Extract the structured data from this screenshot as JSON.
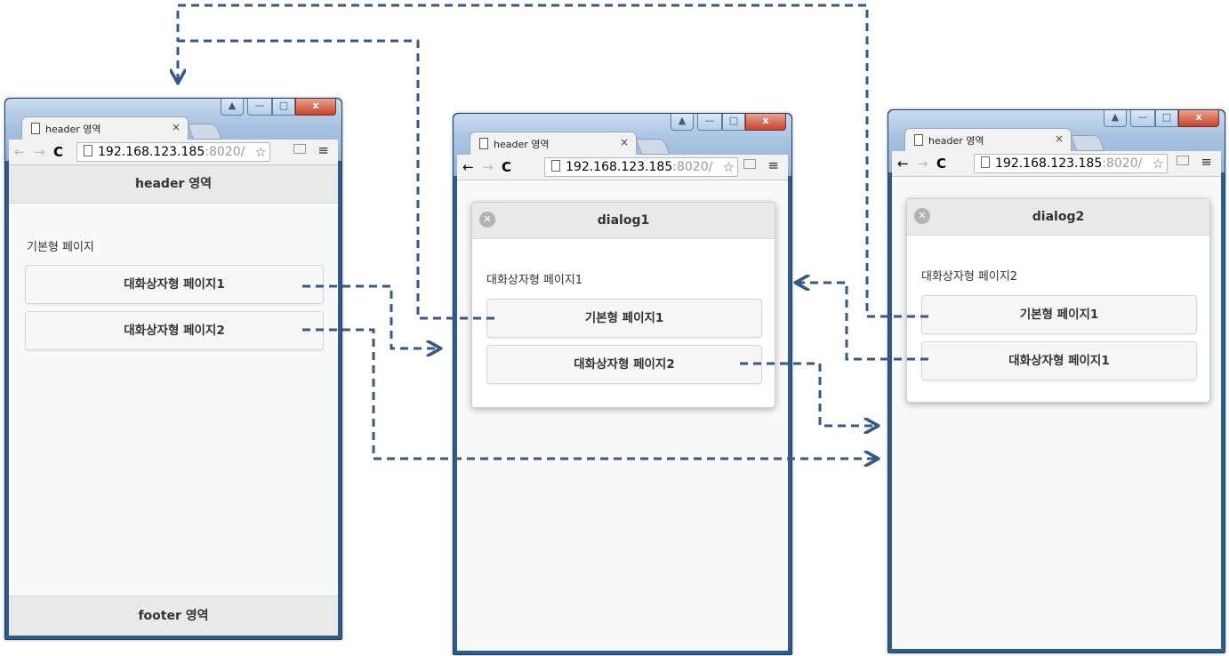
{
  "browser": {
    "tab_title": "header 영역",
    "tab_close": "×",
    "url_main": "192.168.123.185",
    "url_rest": ":8020/",
    "back": "←",
    "forward": "→",
    "reload": "C",
    "star": "☆",
    "menu": "≡",
    "win_user": "▲",
    "win_min": "—",
    "win_max": "□",
    "win_close": "x"
  },
  "page_basic": {
    "header": "header 영역",
    "text": "기본형 페이지",
    "buttons": [
      "대화상자형 페이지1",
      "대화상자형 페이지2"
    ],
    "footer": "footer 영역"
  },
  "dialog1": {
    "title": "dialog1",
    "text": "대화상자형 페이지1",
    "buttons": [
      "기본형 페이지1",
      "대화상자형 페이지2"
    ]
  },
  "dialog2": {
    "title": "dialog2",
    "text": "대화상자형 페이지2",
    "buttons": [
      "기본형 페이지1",
      "대화상자형 페이지1"
    ]
  },
  "icons": {
    "dialog_close": "close-circle-icon",
    "arrows": "dashed-arrow-connector",
    "page": "page-icon"
  },
  "colors": {
    "arrow": "#355a87",
    "window_frame": "#2e5b8a"
  }
}
